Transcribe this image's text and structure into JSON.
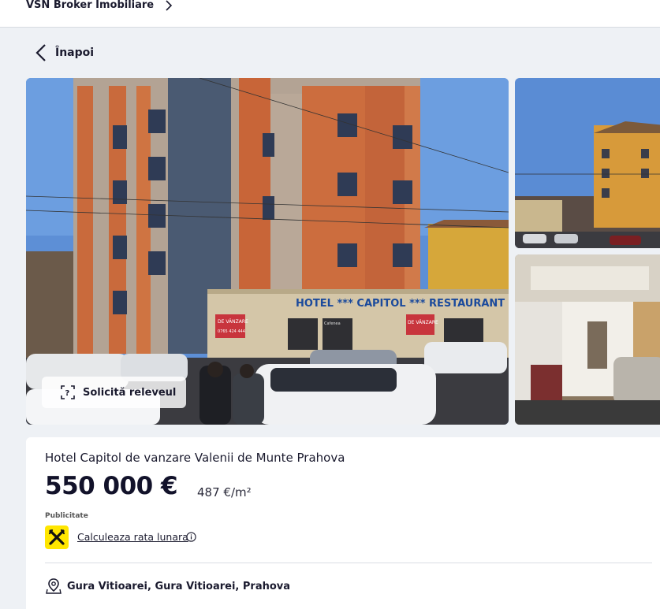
{
  "breadcrumb": {
    "agency": "VSN Broker Imobiliare"
  },
  "nav": {
    "back_label": "Înapoi"
  },
  "gallery": {
    "hotel_sign": "HOTEL *** CAPITOL *** RESTAURANT",
    "sale_sign_1": "DE VÂNZARE",
    "sale_sign_phone": "0765 424 444",
    "sale_sign_2": "DE VÂNZARE",
    "cafe_sign": "Cafenea",
    "relevee_button": "Solicită releveul"
  },
  "listing": {
    "title": "Hotel Capitol de vanzare Valenii de Munte Prahova",
    "price": "550 000 €",
    "price_per_sqm": "487 €/m²",
    "ad_label": "Publicitate",
    "rate_link": "Calculeaza rata lunara",
    "location": "Gura Vitioarei, Gura Vitioarei, Prahova"
  },
  "colors": {
    "accent_yellow": "#ffe600",
    "text_dark": "#1a1a2e",
    "background": "#eef1f5"
  },
  "icons": {
    "chevron": "chevron-right-icon",
    "back": "chevron-left-icon",
    "relevee": "scan-icon",
    "bank": "raiffeisen-logo",
    "info": "info-icon",
    "location": "map-pin-icon"
  }
}
